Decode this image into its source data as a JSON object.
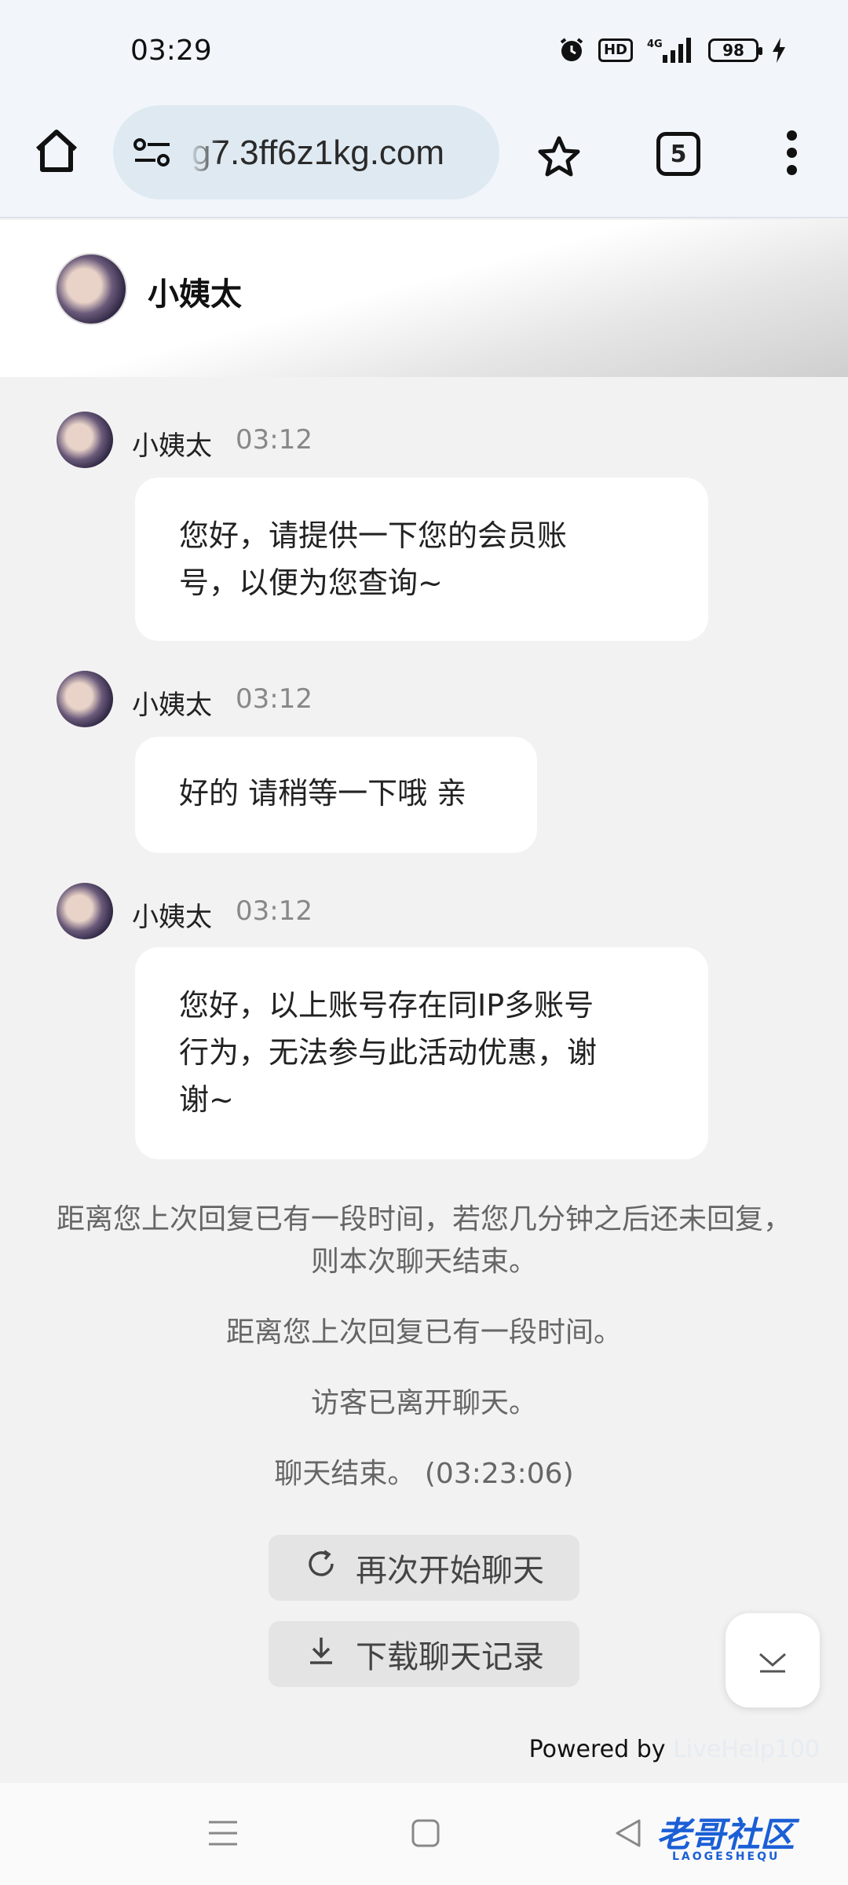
{
  "status_bar": {
    "time": "03:29",
    "hd_label": "HD",
    "network_label": "4G",
    "battery_level": "98"
  },
  "browser": {
    "url": "g7.3ff6z1kg.com",
    "tab_count": "5"
  },
  "chat": {
    "agent_name": "小姨太",
    "messages": [
      {
        "name": "小姨太",
        "time": "03:12",
        "text_lines": [
          "您好，请提供一下您的会员账",
          "号，以便为您查询~"
        ]
      },
      {
        "name": "小姨太",
        "time": "03:12",
        "text_lines": [
          "好的 请稍等一下哦 亲"
        ]
      },
      {
        "name": "小姨太",
        "time": "03:12",
        "text_lines": [
          "您好，以上账号存在同IP多账号",
          "行为，无法参与此活动优惠，谢",
          "谢~"
        ]
      }
    ],
    "system_messages": [
      "距离您上次回复已有一段时间，若您几分钟之后还未回复，则本次聊天结束。",
      "距离您上次回复已有一段时间。",
      "访客已离开聊天。",
      "聊天结束。 (03:23:06)"
    ],
    "restart_label": "再次开始聊天",
    "download_label": "下载聊天记录",
    "powered_prefix": "Powered by",
    "powered_brand": "LiveHelp100"
  },
  "watermark": {
    "main": "老哥社区",
    "sub": "LAOGESHEQU"
  }
}
